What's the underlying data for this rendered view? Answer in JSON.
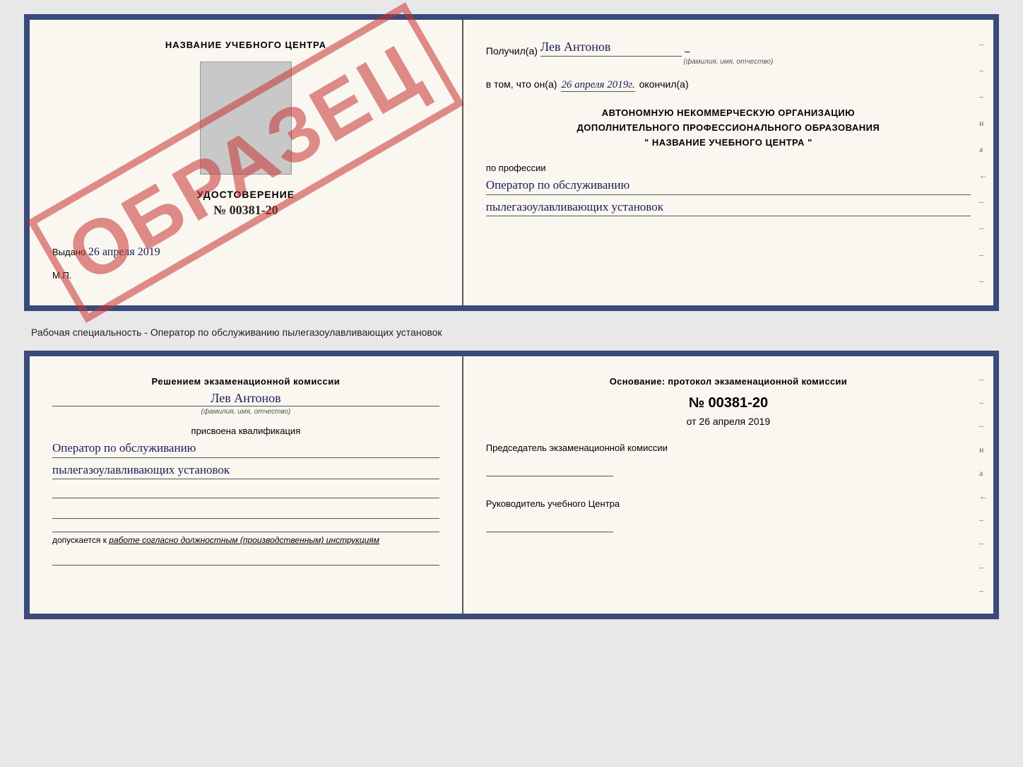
{
  "top_cert": {
    "left": {
      "center_title": "НАЗВАНИЕ УЧЕБНОГО ЦЕНТРА",
      "watermark": "ОБРАЗЕЦ",
      "udostoverenie_label": "УДОСТОВЕРЕНИЕ",
      "number": "№ 00381-20",
      "vydano_label": "Выдано",
      "vydano_date": "26 апреля 2019",
      "mp_label": "М.П."
    },
    "right": {
      "poluchil_label": "Получил(а)",
      "recipient_name": "Лев Антонов",
      "fio_hint": "(фамилия, имя, отчество)",
      "vtom_label": "в том, что он(а)",
      "date_value": "26 апреля 2019г.",
      "okonchil_label": "окончил(а)",
      "org_line1": "АВТОНОМНУЮ НЕКОММЕРЧЕСКУЮ ОРГАНИЗАЦИЮ",
      "org_line2": "ДОПОЛНИТЕЛЬНОГО ПРОФЕССИОНАЛЬНОГО ОБРАЗОВАНИЯ",
      "org_quote1": "\"",
      "org_name": "НАЗВАНИЕ УЧЕБНОГО ЦЕНТРА",
      "org_quote2": "\"",
      "po_professii_label": "по профессии",
      "profession_line1": "Оператор по обслуживанию",
      "profession_line2": "пылегазоулавливающих установок"
    }
  },
  "separator": {
    "text": "Рабочая специальность - Оператор по обслуживанию пылегазоулавливающих установок"
  },
  "bottom_cert": {
    "left": {
      "resheniyem_label": "Решением экзаменационной комиссии",
      "recipient_name": "Лев Антонов",
      "fio_hint": "(фамилия, имя, отчество)",
      "prisvoena_label": "присвоена квалификация",
      "kval_line1": "Оператор по обслуживанию",
      "kval_line2": "пылегазоулавливающих установок",
      "dopuskaetsya_label": "допускается к",
      "dopuskaetsya_text": "работе согласно должностным (производственным) инструкциям"
    },
    "right": {
      "osnovanie_label": "Основание: протокол экзаменационной комиссии",
      "protocol_number": "№ 00381-20",
      "ot_label": "от",
      "ot_date": "26 апреля 2019",
      "predsedatel_label": "Председатель экзаменационной комиссии",
      "rukovoditel_label": "Руководитель учебного Центра"
    }
  },
  "side_dashes": [
    "–",
    "–",
    "–",
    "и",
    "а",
    "←",
    "–",
    "–",
    "–",
    "–"
  ]
}
